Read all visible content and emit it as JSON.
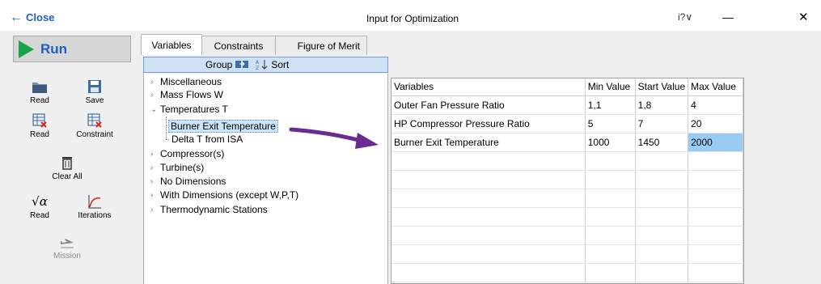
{
  "window": {
    "close_label": "Close",
    "title": "Input for Optimization",
    "help_label": "i?",
    "minimize_glyph": "—",
    "close_glyph": "✕"
  },
  "toolbar": {
    "run_label": "Run",
    "read1": "Read",
    "save": "Save",
    "read2": "Read",
    "constraint": "Constraint",
    "clear_all": "Clear All",
    "read3": "Read",
    "iterations": "Iterations",
    "mission": "Mission"
  },
  "tabs": [
    {
      "label": "Variables",
      "active": true
    },
    {
      "label": "Constraints",
      "active": false
    },
    {
      "label": "Figure of Merit",
      "active": false
    }
  ],
  "tree_toolbar": {
    "group_label": "Group",
    "sort_label": "Sort"
  },
  "tree": {
    "items": [
      {
        "label": "Miscellaneous",
        "expanded": false
      },
      {
        "label": "Mass Flows W",
        "expanded": false
      },
      {
        "label": "Temperatures T",
        "expanded": true
      },
      {
        "label": "Compressor(s)",
        "expanded": false
      },
      {
        "label": "Turbine(s)",
        "expanded": false
      },
      {
        "label": "No Dimensions",
        "expanded": false
      },
      {
        "label": "With Dimensions (except W,P,T)",
        "expanded": false
      },
      {
        "label": "Thermodynamic Stations",
        "expanded": false
      }
    ],
    "children": [
      {
        "label": "Burner Exit Temperature",
        "selected": true
      },
      {
        "label": "Delta T from ISA",
        "selected": false
      }
    ]
  },
  "grid": {
    "columns": [
      "Variables",
      "Min Value",
      "Start Value",
      "Max Value"
    ],
    "rows": [
      [
        "Outer Fan Pressure Ratio",
        "1,1",
        "1,8",
        "4"
      ],
      [
        "HP Compressor Pressure Ratio",
        "5",
        "7",
        "20"
      ],
      [
        "Burner Exit Temperature",
        "1000",
        "1450",
        "2000"
      ]
    ]
  },
  "colors": {
    "accent": "#1f5fbf",
    "run_green": "#1aa34a",
    "arrow_purple": "#6a2c91",
    "selected_cell": "#99ccf4"
  }
}
